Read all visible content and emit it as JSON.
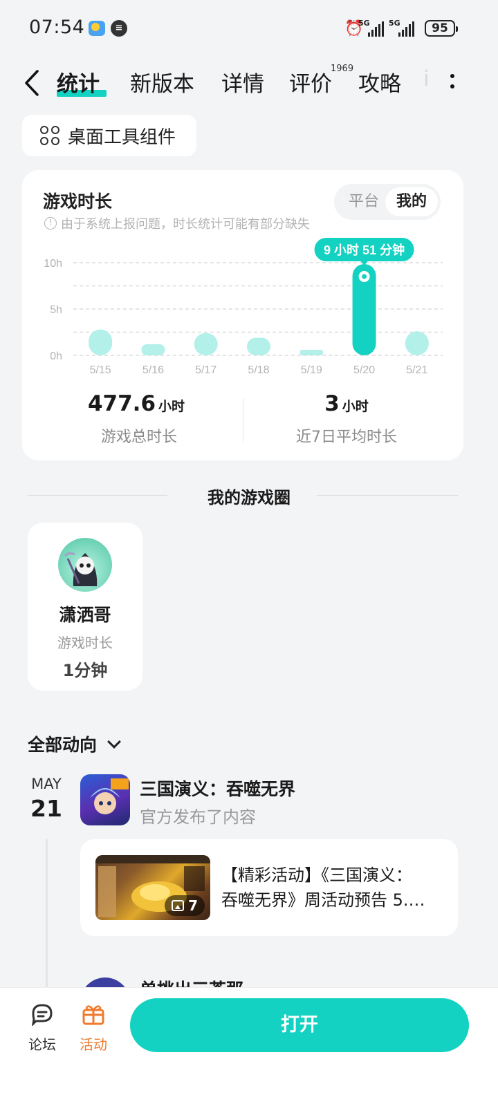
{
  "status_bar": {
    "time": "07:54",
    "network_1": "5G",
    "network_2": "5G",
    "battery": "95"
  },
  "header": {
    "tabs": [
      {
        "label": "统计",
        "active": true
      },
      {
        "label": "新版本"
      },
      {
        "label": "详情"
      },
      {
        "label": "评价",
        "badge": "1969"
      },
      {
        "label": "攻略"
      }
    ],
    "tab_cut": "i"
  },
  "widget_chip": {
    "label": "桌面工具组件"
  },
  "playtime_card": {
    "title": "游戏时长",
    "note": "由于系统上报问题，时长统计可能有部分缺失",
    "toggle": {
      "option_1": "平台",
      "option_2": "我的",
      "selected": "我的"
    },
    "tooltip": "9 小时 51 分钟",
    "total": {
      "value": "477.6",
      "unit": "小时",
      "label": "游戏总时长"
    },
    "average": {
      "value": "3",
      "unit": "小时",
      "label": "近7日平均时长"
    }
  },
  "chart_data": {
    "type": "bar",
    "categories": [
      "5/15",
      "5/16",
      "5/17",
      "5/18",
      "5/19",
      "5/20",
      "5/21"
    ],
    "values": [
      2.8,
      1.2,
      2.4,
      1.9,
      0.6,
      9.85,
      2.6
    ],
    "highlight_index": 5,
    "yticks": [
      "10h",
      "5h",
      "0h"
    ],
    "ylim": [
      0,
      10
    ],
    "grid": true,
    "colors": {
      "bar": "#b3f0ea",
      "highlight": "#13d2c1"
    }
  },
  "circle": {
    "title": "我的游戏圈",
    "friend": {
      "name": "潇洒哥",
      "sub_label": "游戏时长",
      "value": "1分钟"
    }
  },
  "feed": {
    "filter_label": "全部动向",
    "items": [
      {
        "month": "MAY",
        "day": "21",
        "game": "三国演义：吞噬无界",
        "action": "官方发布了内容",
        "post_line_1": "【精彩活动】《三国演义：",
        "post_line_2": "吞噬无界》周活动预告 5.…",
        "image_count": "7"
      }
    ],
    "peek_title": "单挑出三苍那"
  },
  "bottom_bar": {
    "forum": "论坛",
    "activity": "活动",
    "open": "打开",
    "colors": {
      "accent": "#13d2c1",
      "activity": "#f07a2c"
    }
  }
}
